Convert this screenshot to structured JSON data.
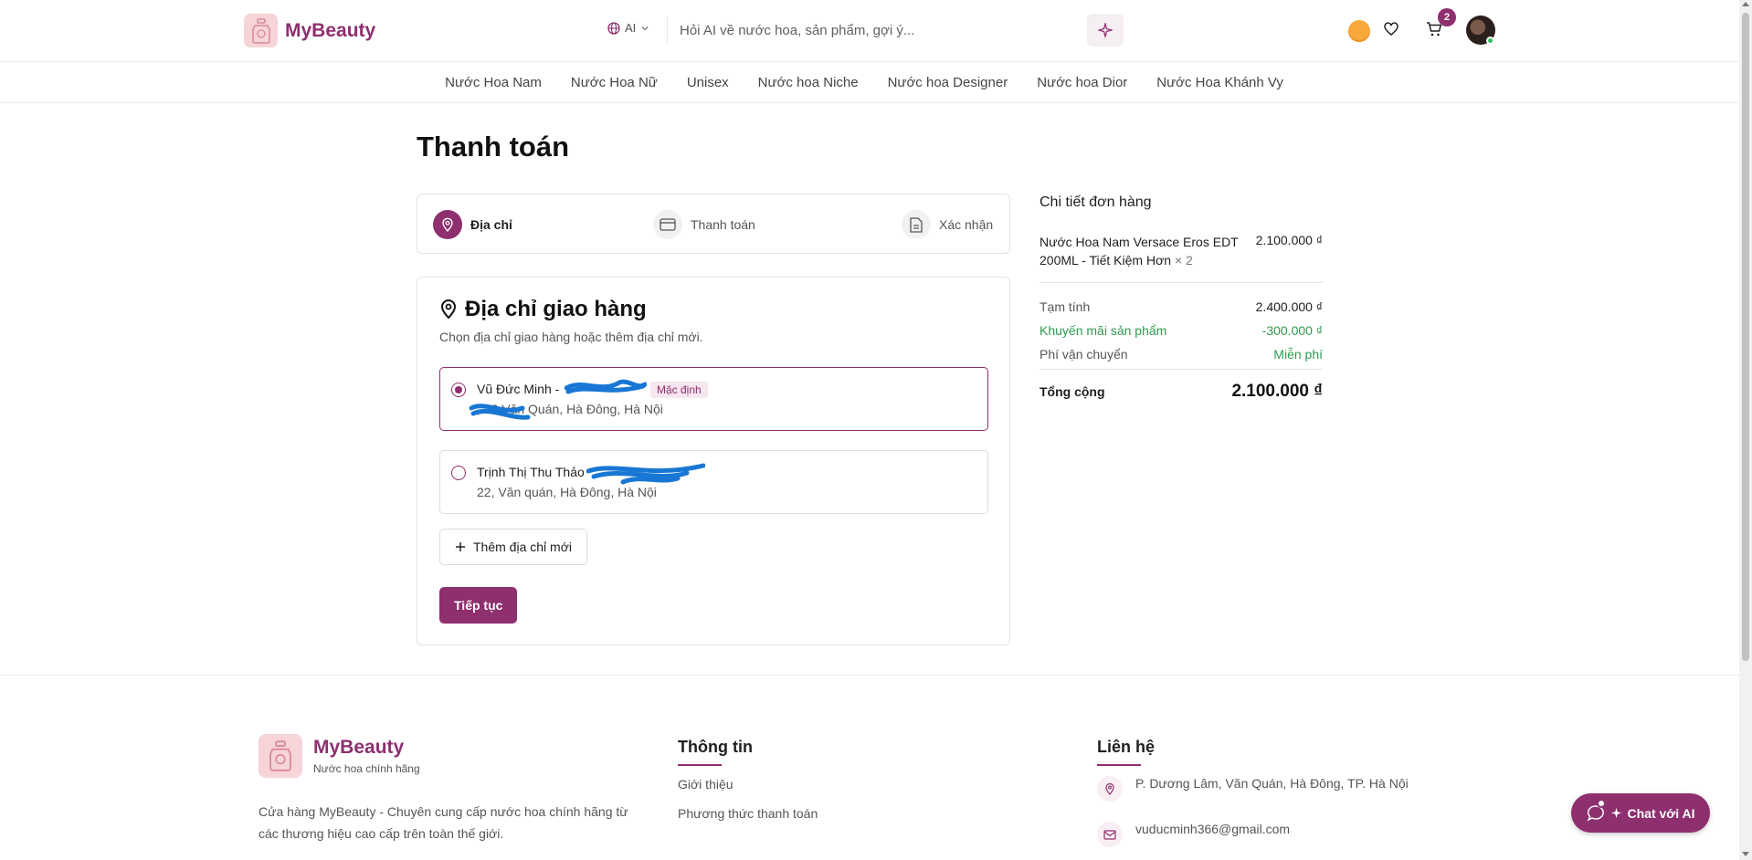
{
  "brand": {
    "name": "MyBeauty",
    "tagline": "Nước hoa chính hãng"
  },
  "header": {
    "ai_label": "AI",
    "search_placeholder": "Hỏi AI về nước hoa, sản phẩm, gợi ý...",
    "cart_count": "2"
  },
  "nav": {
    "items": [
      "Nước Hoa Nam",
      "Nước Hoa Nữ",
      "Unisex",
      "Nước hoa Niche",
      "Nước hoa Designer",
      "Nước hoa Dior",
      "Nước Hoa Khánh Vy"
    ]
  },
  "page": {
    "title": "Thanh toán"
  },
  "steps": [
    {
      "label": "Địa chỉ",
      "icon": "map-pin-icon",
      "active": true
    },
    {
      "label": "Thanh toán",
      "icon": "credit-card-icon",
      "active": false
    },
    {
      "label": "Xác nhận",
      "icon": "document-icon",
      "active": false
    }
  ],
  "address": {
    "title": "Địa chỉ giao hàng",
    "subtitle": "Chọn địa chỉ giao hàng hoặc thêm địa chỉ mới.",
    "options": [
      {
        "name": "Vũ Đức Minh - ",
        "address": ", 22 Văn Quán, Hà Đông, Hà Nội",
        "badge": "Mặc định",
        "selected": true
      },
      {
        "name": "Trịnh Thị Thu Thảo",
        "address": "22, Văn quán, Hà Đông, Hà Nội",
        "selected": false
      }
    ],
    "add_label": "Thêm địa chỉ mới",
    "continue_label": "Tiếp tục"
  },
  "summary": {
    "title": "Chi tiết đơn hàng",
    "item": {
      "name": "Nước Hoa Nam Versace Eros EDT 200ML - Tiết Kiệm Hơn",
      "qty": "× 2",
      "price": "2.100.000 ₫"
    },
    "subtotal_label": "Tạm tính",
    "subtotal": "2.400.000 ₫",
    "discount_label": "Khuyến mãi sản phẩm",
    "discount": "-300.000 ₫",
    "shipping_label": "Phí vận chuyển",
    "shipping": "Miễn phí",
    "total_label": "Tổng cộng",
    "total": "2.100.000 ₫"
  },
  "footer": {
    "description": "Cửa hàng MyBeauty - Chuyên cung cấp nước hoa chính hãng từ các thương hiệu cao cấp trên toàn thế giới.",
    "info_title": "Thông tin",
    "info_links": [
      "Giới thiệu",
      "Phương thức thanh toán"
    ],
    "contact_title": "Liên hệ",
    "address": "P. Dương Lâm, Văn Quán, Hà Đông, TP. Hà Nội",
    "email": "vuducminh366@gmail.com"
  },
  "chat": {
    "label": "Chat với AI"
  },
  "colors": {
    "brand": "#8e2f6e",
    "green": "#2e9a4e",
    "logo_bg": "#f6d4d8"
  }
}
